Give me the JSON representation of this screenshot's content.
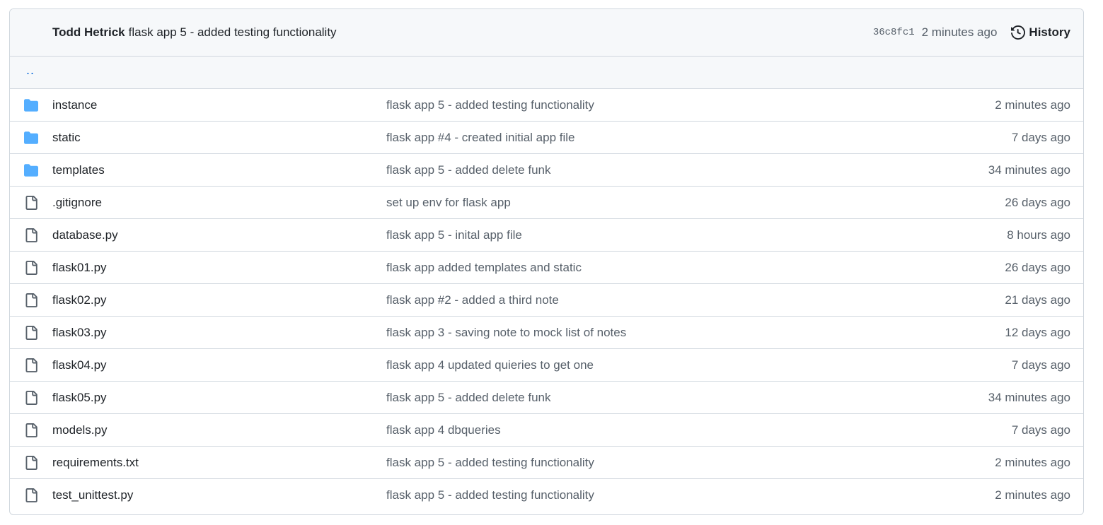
{
  "commit": {
    "author": "Todd Hetrick",
    "message": "flask app 5 - added testing functionality",
    "sha": "36c8fc1",
    "time": "2 minutes ago",
    "history_label": "History"
  },
  "parent_link": "..",
  "colors": {
    "folder": "#54aeff",
    "file": "#57606a",
    "link": "#0969da",
    "border": "#d0d7de",
    "header_bg": "#f6f8fa"
  },
  "files": [
    {
      "type": "folder",
      "icon": "folder-icon",
      "name": "instance",
      "message": "flask app 5 - added testing functionality",
      "age": "2 minutes ago"
    },
    {
      "type": "folder",
      "icon": "folder-icon",
      "name": "static",
      "message": "flask app #4 - created initial app file",
      "age": "7 days ago"
    },
    {
      "type": "folder",
      "icon": "folder-icon",
      "name": "templates",
      "message": "flask app 5 - added delete funk",
      "age": "34 minutes ago"
    },
    {
      "type": "file",
      "icon": "file-icon",
      "name": ".gitignore",
      "message": "set up env for flask app",
      "age": "26 days ago"
    },
    {
      "type": "file",
      "icon": "file-icon",
      "name": "database.py",
      "message": "flask app 5 - inital app file",
      "age": "8 hours ago"
    },
    {
      "type": "file",
      "icon": "file-icon",
      "name": "flask01.py",
      "message": "flask app added templates and static",
      "age": "26 days ago"
    },
    {
      "type": "file",
      "icon": "file-icon",
      "name": "flask02.py",
      "message": "flask app #2 - added a third note",
      "age": "21 days ago"
    },
    {
      "type": "file",
      "icon": "file-icon",
      "name": "flask03.py",
      "message": "flask app 3 - saving note to mock list of notes",
      "age": "12 days ago"
    },
    {
      "type": "file",
      "icon": "file-icon",
      "name": "flask04.py",
      "message": "flask app 4 updated quieries to get one",
      "age": "7 days ago"
    },
    {
      "type": "file",
      "icon": "file-icon",
      "name": "flask05.py",
      "message": "flask app 5 - added delete funk",
      "age": "34 minutes ago"
    },
    {
      "type": "file",
      "icon": "file-icon",
      "name": "models.py",
      "message": "flask app 4 dbqueries",
      "age": "7 days ago"
    },
    {
      "type": "file",
      "icon": "file-icon",
      "name": "requirements.txt",
      "message": "flask app 5 - added testing functionality",
      "age": "2 minutes ago"
    },
    {
      "type": "file",
      "icon": "file-icon",
      "name": "test_unittest.py",
      "message": "flask app 5 - added testing functionality",
      "age": "2 minutes ago"
    }
  ]
}
